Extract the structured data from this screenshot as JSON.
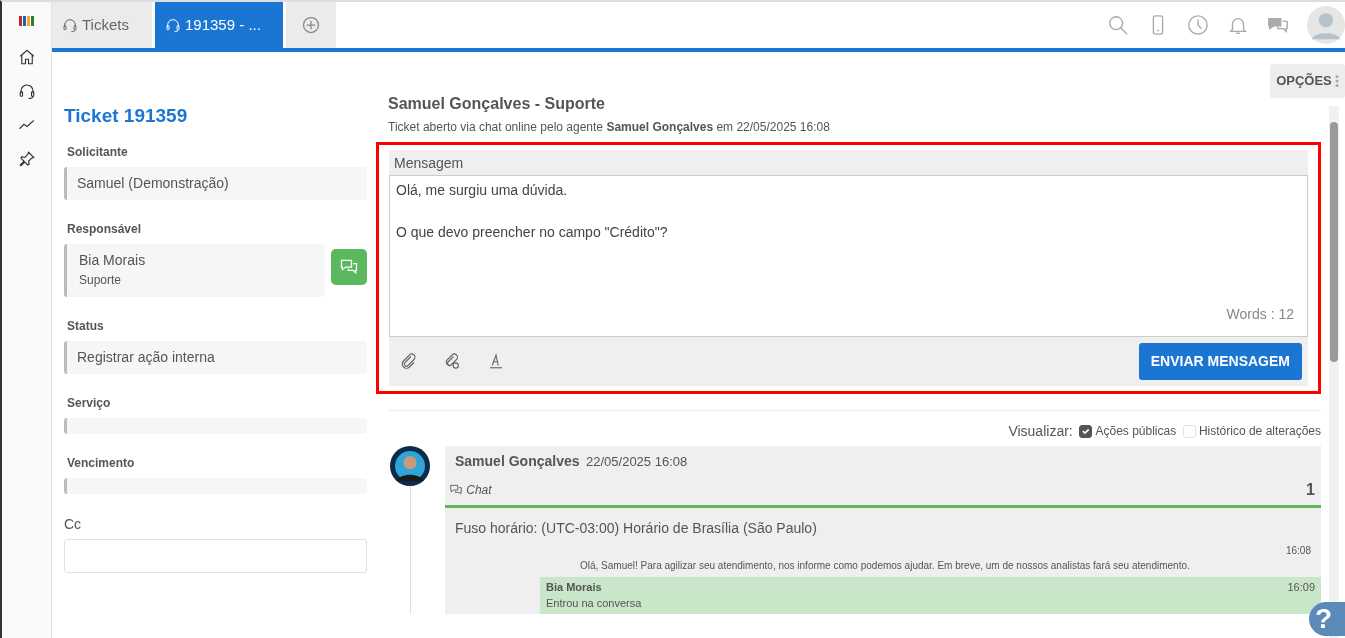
{
  "tabs": [
    {
      "label": "Tickets",
      "selected": false
    },
    {
      "label": "191359 - ...",
      "selected": true
    }
  ],
  "options_button": "OPÇÕES",
  "help_button": "?",
  "ticket": {
    "title": "Ticket 191359",
    "fields": [
      {
        "kind": "text",
        "label": "Solicitante",
        "value": "Samuel (Demonstração)"
      },
      {
        "kind": "person",
        "label": "Responsável",
        "value": "Bia Morais",
        "sub": "Suporte"
      },
      {
        "kind": "text",
        "label": "Status",
        "value": "Registrar ação interna"
      },
      {
        "kind": "empty",
        "label": "Serviço"
      },
      {
        "kind": "empty",
        "label": "Vencimento"
      },
      {
        "kind": "input",
        "label": "Cc"
      }
    ]
  },
  "conversation": {
    "title": "Samuel Gonçalves - Suporte",
    "subtitle": "Ticket aberto via chat online pelo agente **Samuel Gonçalves** em 22/05/2025 16:08",
    "composer": {
      "label": "Mensagem",
      "value": "Olá, me surgiu uma dúvida.\n\nO que devo preencher no campo \"Crédito\"?",
      "word_count": "Words : 12",
      "send": "ENVIAR MENSAGEM"
    },
    "filter_label": "Visualizar:",
    "filters": [
      {
        "label": "Ações públicas",
        "checked": true
      },
      {
        "label": "Histórico de alterações",
        "checked": false
      }
    ],
    "entry": {
      "author": "Samuel Gonçalves",
      "time": "22/05/2025 16:08",
      "channel": "Chat",
      "number": "1",
      "timezone": "Fuso horário: (UTC-03:00) Horário de Brasília (São Paulo)",
      "messages": [
        {
          "kind": "system",
          "time": "16:08",
          "text": "Olá, Samuel! Para agilizar seu atendimento, nos informe como podemos ajudar. Em breve, um de nossos analistas fará seu atendimento."
        },
        {
          "kind": "agent",
          "author": "Bia Morais",
          "time": "16:09",
          "text": "Entrou na conversa"
        }
      ]
    }
  }
}
